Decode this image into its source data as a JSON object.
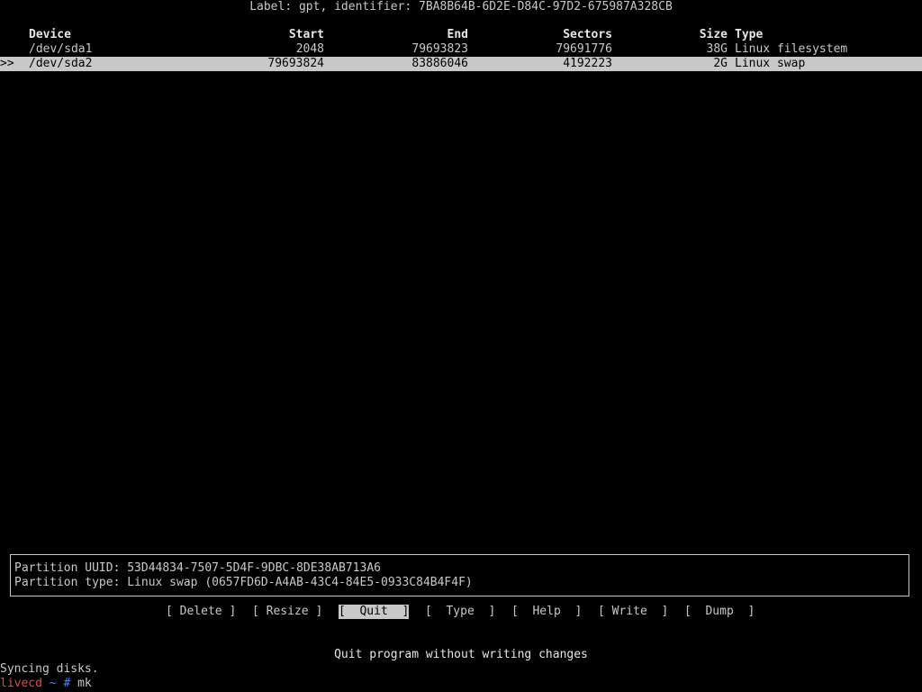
{
  "disk": {
    "label_line": "Label: gpt, identifier: 7BA8B64B-6D2E-D84C-97D2-675987A328CB"
  },
  "table": {
    "headers": {
      "device": "Device",
      "start": "Start",
      "end": "End",
      "sectors": "Sectors",
      "size": "Size",
      "type": "Type"
    },
    "rows": [
      {
        "pointer": "",
        "device": "/dev/sda1",
        "start": "2048",
        "end": "79693823",
        "sectors": "79691776",
        "size": "38G",
        "type": "Linux filesystem",
        "selected": false
      },
      {
        "pointer": ">>",
        "device": "/dev/sda2",
        "start": "79693824",
        "end": "83886046",
        "sectors": "4192223",
        "size": "2G",
        "type": "Linux swap",
        "selected": true
      }
    ]
  },
  "info": {
    "uuid_line": "Partition UUID: 53D44834-7507-5D4F-9DBC-8DE38AB713A6",
    "type_line": "Partition type: Linux swap (0657FD6D-A4AB-43C4-84E5-0933C84B4F4F)"
  },
  "menu": {
    "items": [
      {
        "text": "[ Delete ]",
        "active": false
      },
      {
        "text": "[ Resize ]",
        "active": false
      },
      {
        "text": "[  Quit  ]",
        "active": true
      },
      {
        "text": "[  Type  ]",
        "active": false
      },
      {
        "text": "[  Help  ]",
        "active": false
      },
      {
        "text": "[ Write  ]",
        "active": false
      },
      {
        "text": "[  Dump  ]",
        "active": false
      }
    ]
  },
  "hint": "Quit program without writing changes",
  "console": {
    "sync": "Syncing disks.",
    "prompt": {
      "host": "livecd",
      "tilde": "~",
      "hash": "#",
      "command": "mk"
    }
  },
  "colors": {
    "background": "#000000",
    "foreground": "#c8c8c8",
    "highlight": "#c8c8c8",
    "prompt_host": "#d94b4b",
    "prompt_path": "#5a7dff"
  }
}
